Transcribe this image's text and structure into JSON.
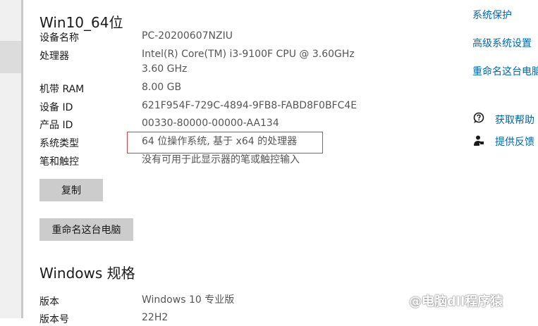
{
  "device_section": {
    "heading": "Win10_64位",
    "rows": [
      {
        "label": "设备名称",
        "value": "PC-20200607NZIU"
      },
      {
        "label": "处理器",
        "value": "Intel(R) Core(TM) i3-9100F CPU @ 3.60GHz",
        "value2": "3.60 GHz"
      },
      {
        "label": "机带 RAM",
        "value": "8.00 GB"
      },
      {
        "label": "设备 ID",
        "value": "621F954F-729C-4894-9FB8-FABD8F0BFC4E"
      },
      {
        "label": "产品 ID",
        "value": "00330-80000-00000-AA134"
      },
      {
        "label": "系统类型",
        "value": "64 位操作系统, 基于 x64 的处理器"
      },
      {
        "label": "笔和触控",
        "value": "没有可用于此显示器的笔或触控输入"
      }
    ],
    "copy_button": "复制",
    "rename_button": "重命名这台电脑"
  },
  "windows_section": {
    "heading": "Windows 规格",
    "rows": [
      {
        "label": "版本",
        "value": "Windows 10 专业版"
      },
      {
        "label": "版本号",
        "value": "22H2"
      }
    ]
  },
  "related_links": [
    "系统保护",
    "高级系统设置",
    "重命名这台电脑"
  ],
  "help_links": [
    {
      "label": "获取帮助",
      "icon": "help-chat-icon"
    },
    {
      "label": "提供反馈",
      "icon": "feedback-icon"
    }
  ],
  "watermark": "@电脑dll程序猿",
  "colors": {
    "link": "#0066b4",
    "highlight": "#d94040",
    "button": "#cccccc"
  }
}
